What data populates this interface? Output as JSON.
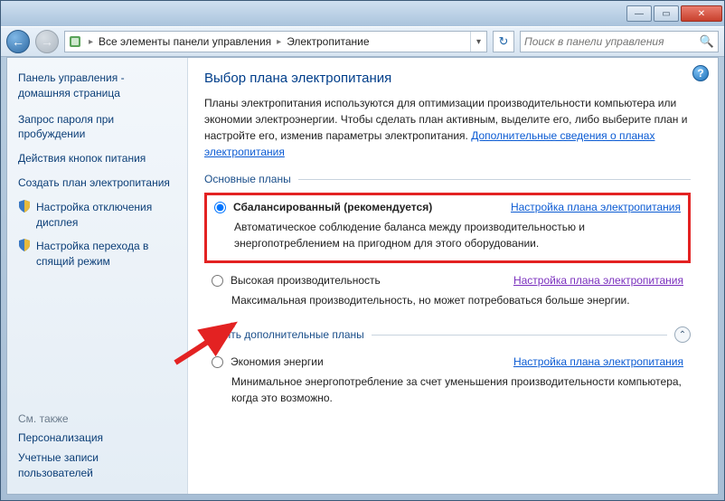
{
  "titlebar": {
    "min": "—",
    "max": "▭",
    "close": "✕"
  },
  "nav": {
    "back_glyph": "←",
    "fwd_glyph": "→"
  },
  "breadcrumb": {
    "item1": "Все элементы панели управления",
    "item2": "Электропитание",
    "sep": "▸"
  },
  "refresh_glyph": "↻",
  "search": {
    "placeholder": "Поиск в панели управления",
    "icon": "🔍"
  },
  "sidebar": {
    "home": "Панель управления - домашняя страница",
    "links": [
      "Запрос пароля при пробуждении",
      "Действия кнопок питания",
      "Создать план электропитания"
    ],
    "shield_links": [
      "Настройка отключения дисплея",
      "Настройка перехода в спящий режим"
    ],
    "see_also_label": "См. также",
    "see_also": [
      "Персонализация",
      "Учетные записи пользователей"
    ]
  },
  "main": {
    "help": "?",
    "title": "Выбор плана электропитания",
    "intro_text": "Планы электропитания используются для оптимизации производительности компьютера или экономии электроэнергии. Чтобы сделать план активным, выделите его, либо выберите план и настройте его, изменив параметры электропитания. ",
    "intro_link": "Дополнительные сведения о планах электропитания",
    "section_main": "Основные планы",
    "plans": [
      {
        "name": "Сбалансированный (рекомендуется)",
        "desc": "Автоматическое соблюдение баланса между производительностью и энергопотреблением на пригодном для этого оборудовании.",
        "settings": "Настройка плана электропитания",
        "checked": true
      },
      {
        "name": "Высокая производительность",
        "desc": "Максимальная производительность, но может потребоваться больше энергии.",
        "settings": "Настройка плана электропитания",
        "checked": false
      }
    ],
    "collapse_label": "Скрыть дополнительные планы",
    "collapse_glyph": "⌃",
    "extra_plan": {
      "name": "Экономия энергии",
      "desc": "Минимальное энергопотребление за счет уменьшения производительности компьютера, когда это возможно.",
      "settings": "Настройка плана электропитания"
    }
  }
}
